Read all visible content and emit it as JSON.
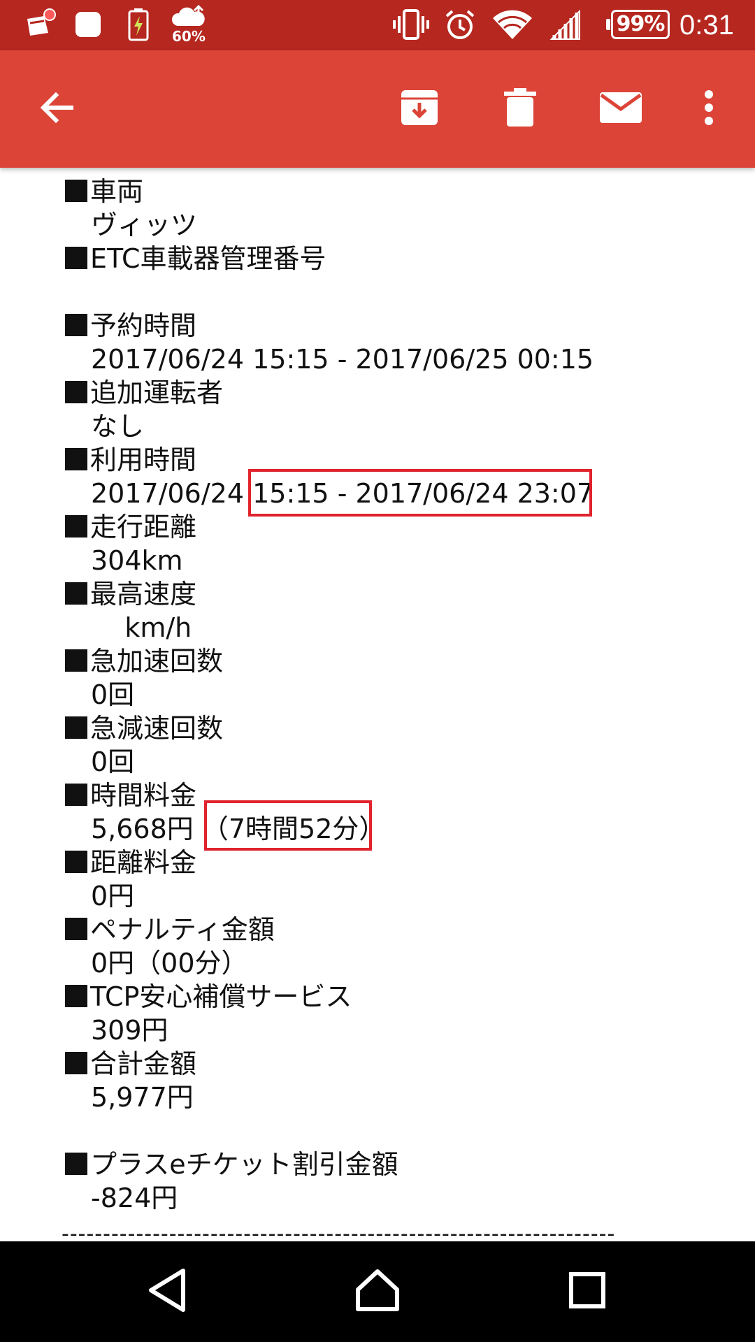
{
  "status_bar": {
    "cloud_label": "60%",
    "battery": "99%",
    "time": "0:31",
    "icons": [
      "notification-app-icon",
      "square-app-icon",
      "battery-charging-icon",
      "cloud-upload-icon",
      "vibrate-icon",
      "alarm-icon",
      "wifi-icon",
      "signal-icon"
    ]
  },
  "app_bar": {
    "icons": [
      "back-arrow-icon",
      "archive-icon",
      "delete-icon",
      "mark-unread-icon",
      "more-vert-icon"
    ]
  },
  "email": {
    "sections": [
      {
        "label": "車両",
        "value": "ヴィッツ"
      },
      {
        "label": "ETC車載器管理番号",
        "value": ""
      },
      {
        "label": "予約時間",
        "value": "2017/06/24 15:15 - 2017/06/25 00:15"
      },
      {
        "label": "追加運転者",
        "value": "なし"
      },
      {
        "label": "利用時間",
        "value": "2017/06/24 15:15 - 2017/06/24 23:07"
      },
      {
        "label": "走行距離",
        "value": "304km"
      },
      {
        "label": "最高速度",
        "value": "    km/h"
      },
      {
        "label": "急加速回数",
        "value": "0回"
      },
      {
        "label": "急減速回数",
        "value": "0回"
      },
      {
        "label": "時間料金",
        "value": "5,668円 （7時間52分）"
      },
      {
        "label": "距離料金",
        "value": "0円"
      },
      {
        "label": "ペナルティ金額",
        "value": "0円（00分）"
      },
      {
        "label": "TCP安心補償サービス",
        "value": "309円"
      },
      {
        "label": "合計金額",
        "value": "5,977円"
      },
      {
        "label": "プラスeチケット割引金額",
        "value": "-824円"
      }
    ],
    "divider": "--------------------------------------------------------------------"
  },
  "nav_bar": {
    "icons": [
      "nav-back-icon",
      "nav-home-icon",
      "nav-recents-icon"
    ]
  },
  "colors": {
    "status_bar": "#b5271f",
    "app_bar": "#db4437",
    "highlight": "#e0232c",
    "nav_bar": "#000000"
  }
}
